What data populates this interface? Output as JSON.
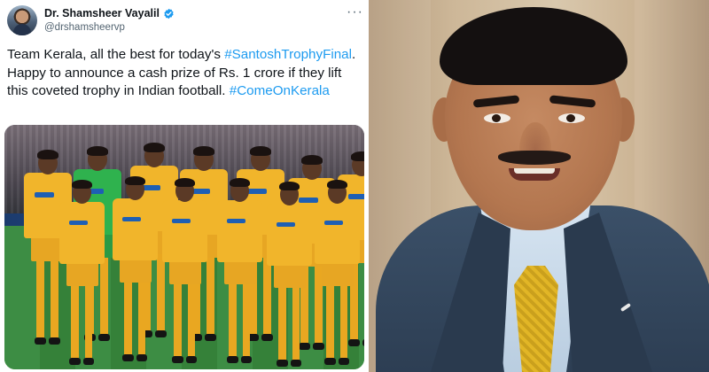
{
  "tweet": {
    "display_name": "Dr. Shamsheer Vayalil",
    "handle": "@drshamsheervp",
    "verified_icon": "verified-badge-icon",
    "more_icon": "more-options-icon",
    "text": {
      "line1": "Team Kerala, all the best for today's",
      "hashtag1": "#SantoshTrophyFinal",
      "line2_rest": ". Happy to announce a cash prize of Rs. 1 crore if they lift this coveted trophy in Indian football. ",
      "hashtag2": "#ComeOnKerala"
    },
    "media": {
      "type": "team-photo",
      "kit_color": "#f1b52b",
      "keeper_color": "#2fb24e"
    }
  },
  "photo": {
    "type": "portrait",
    "tie_color": "#e2b626",
    "suit_color": "#2c3d52"
  },
  "colors": {
    "link": "#1d9bf0",
    "text": "#0f1419",
    "muted": "#536471"
  }
}
